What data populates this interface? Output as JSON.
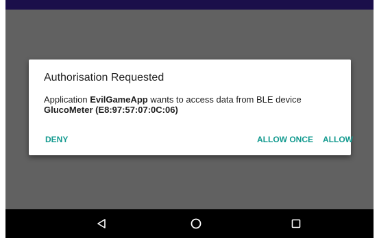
{
  "dialog": {
    "title": "Authorisation Requested",
    "message_prefix": "Application ",
    "app_name": "EvilGameApp",
    "message_middle": " wants to access data from BLE device",
    "device_name": "GlucoMeter (E8:97:57:07:0C:06)",
    "buttons": {
      "deny": "DENY",
      "allow_once": "ALLOW ONCE",
      "allow": "ALLOW"
    }
  },
  "nav_bar": {
    "back_icon": "back-triangle-icon",
    "home_icon": "home-circle-icon",
    "recents_icon": "recents-square-icon"
  },
  "colors": {
    "status_bar": "#1b0f4a",
    "scrim": "#616161",
    "accent": "#139a8f",
    "nav_bar": "#000000"
  }
}
